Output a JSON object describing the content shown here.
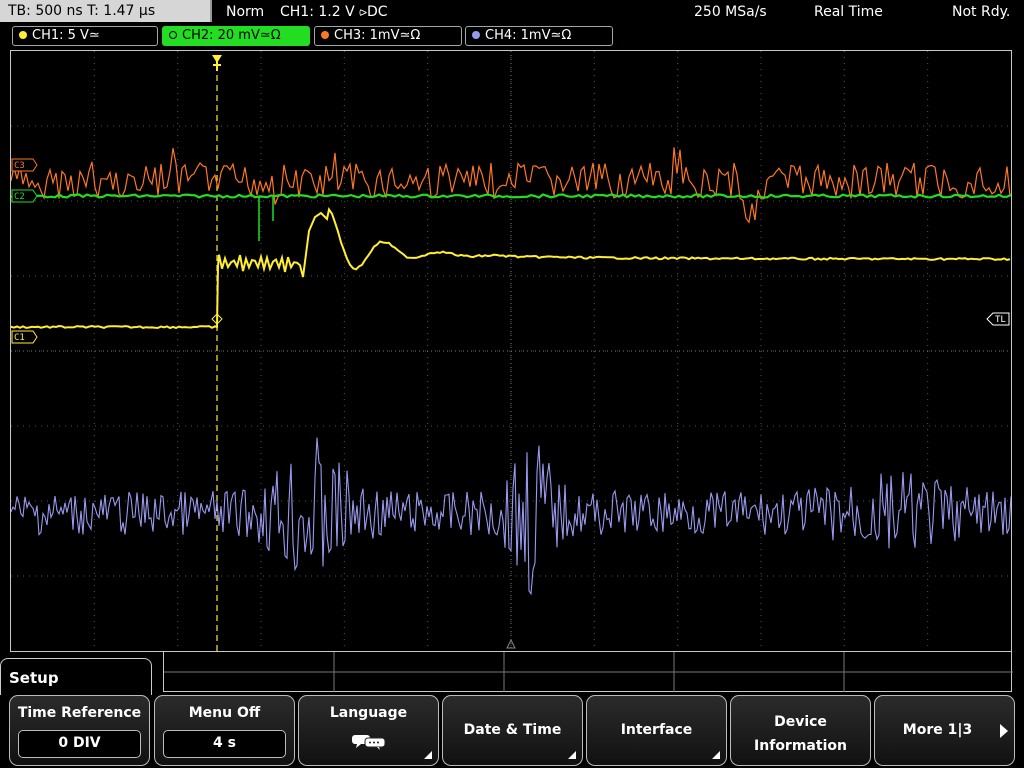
{
  "status_bar": {
    "timebase": "TB: 500 ns  T: 1.47 µs",
    "mode": "Norm",
    "trigger": "CH1: 1.2 V ⪧DC",
    "sample_rate": "250 MSa/s",
    "acq": "Real Time",
    "state": "Not Rdy."
  },
  "channels": [
    {
      "label": "CH1: 5 V≃",
      "color": "#ffee33",
      "active": false
    },
    {
      "label": "CH2: 20 mV≃Ω",
      "color": "#22dd22",
      "active": true
    },
    {
      "label": "CH3: 1mV≃Ω",
      "color": "#ff7722",
      "active": false
    },
    {
      "label": "CH4: 1mV≃Ω",
      "color": "#9999ee",
      "active": false
    }
  ],
  "markers": {
    "c1": "C1",
    "c2": "C2",
    "c3": "C3",
    "trigger_level": "TL",
    "trigger_pos": "T"
  },
  "menu": {
    "title": "Setup",
    "softkeys": [
      {
        "title": "Time Reference",
        "value": "0 DIV"
      },
      {
        "title": "Menu Off",
        "value": "4 s"
      },
      {
        "title": "Language"
      },
      {
        "title": "Date & Time"
      },
      {
        "title": "Interface"
      },
      {
        "title": "Device",
        "title2": "Information"
      },
      {
        "title": "More 1|3"
      }
    ]
  },
  "colors": {
    "ch1": "#ffee33",
    "ch2": "#22dd22",
    "ch3": "#ff7722",
    "ch4": "#9999ee",
    "grid": "#555555"
  }
}
